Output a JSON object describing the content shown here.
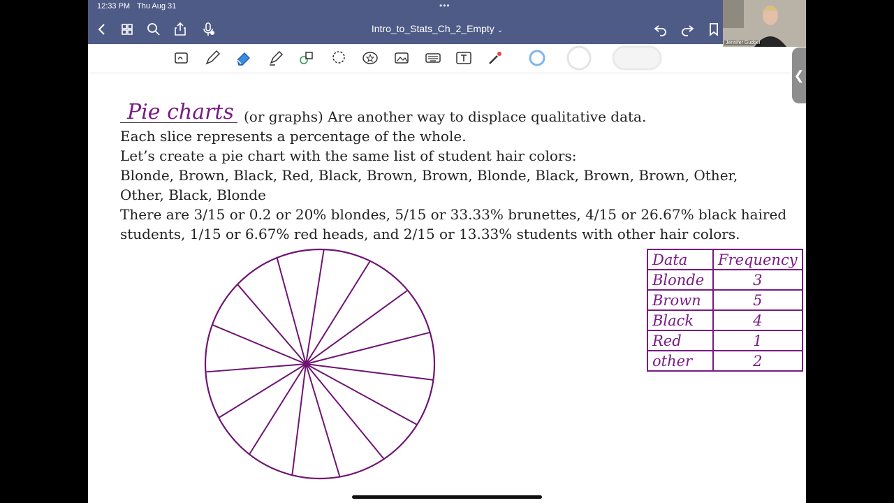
{
  "status_bar": {
    "time": "12:33 PM",
    "date": "Thu Aug 31",
    "dots": "•••"
  },
  "header": {
    "title": "Intro_to_Stats_Ch_2_Empty"
  },
  "webcam": {
    "name": "Jennifer Gudgel"
  },
  "content": {
    "handwritten_title": "Pie charts",
    "lines": [
      "(or graphs) Are another way to displace qualitative data.",
      "Each slice represents a percentage of the whole.",
      "Let’s create a pie chart with the same list of student hair colors:",
      "Blonde, Brown, Black, Red, Black, Brown, Brown, Blonde, Black, Brown, Brown, Other,",
      "Other, Black, Blonde",
      "There are 3/15 or 0.2 or 20% blondes, 5/15 or 33.33% brunettes, 4/15 or 26.67% black haired",
      "students, 1/15 or 6.67% red heads, and 2/15 or 13.33% students with other hair colors."
    ]
  },
  "table": {
    "headers": [
      "Data",
      "Frequency"
    ],
    "rows": [
      [
        "Blonde",
        "3"
      ],
      [
        "Brown",
        "5"
      ],
      [
        "Black",
        "4"
      ],
      [
        "Red",
        "1"
      ],
      [
        "other",
        "2"
      ]
    ]
  },
  "pie": {
    "slices": 15,
    "color": "#6f1474"
  },
  "colors": {
    "header_bg": "#4f5b87",
    "ink": "#7a1a86",
    "accent": "#3b8be0"
  }
}
